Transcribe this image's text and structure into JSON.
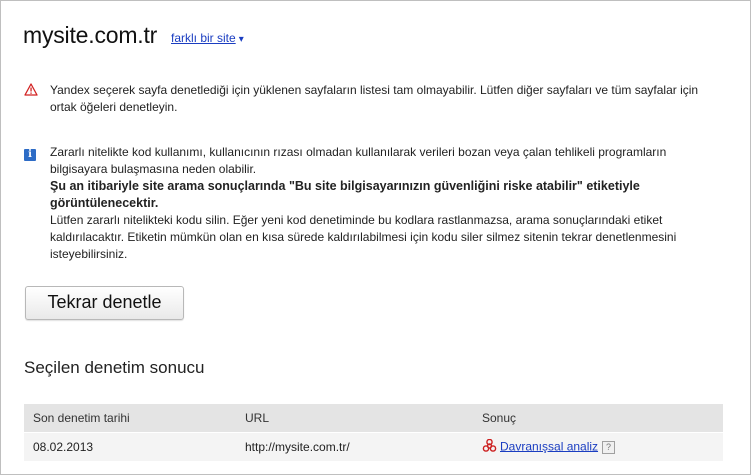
{
  "header": {
    "site_name": "mysite.com.tr",
    "switch_site_label": "farklı bir site",
    "switch_site_arrow": "▾"
  },
  "warning": {
    "icon": "warning-triangle-icon",
    "text": "Yandex seçerek sayfa denetlediği için yüklenen sayfaların listesi tam olmayabilir. Lütfen diğer sayfaları ve tüm sayfalar için ortak öğeleri denetleyin."
  },
  "info": {
    "icon": "info-icon",
    "icon_glyph": "i",
    "line1": "Zararlı nitelikte kod kullanımı, kullanıcının rızası olmadan kullanılarak verileri bozan veya çalan tehlikeli programların bilgisayara bulaşmasına neden olabilir.",
    "bold": "Şu an itibariyle site arama sonuçlarında \"Bu site bilgisayarınızın güvenliğini riske atabilir\" etiketiyle görüntülenecektir.",
    "line2": "Lütfen zararlı nitelikteki kodu silin. Eğer yeni kod denetiminde bu kodlara rastlanmazsa, arama sonuçlarındaki etiket kaldırılacaktır. Etiketin mümkün olan en kısa sürede kaldırılabilmesi için kodu siler silmez sitenin tekrar denetlenmesini isteyebilirsiniz."
  },
  "actions": {
    "recheck_label": "Tekrar denetle"
  },
  "results": {
    "title": "Seçilen denetim sonucu",
    "columns": [
      "Son denetim tarihi",
      "URL",
      "Sonuç"
    ],
    "rows": [
      {
        "date": "08.02.2013",
        "url": "http://mysite.com.tr/",
        "result": "Davranışsal analiz",
        "result_icon": "biohazard-icon",
        "help": "?"
      }
    ]
  },
  "colors": {
    "link": "#1a3dc1",
    "warning": "#d22222",
    "info": "#2d6cc6",
    "hazard": "#cc1f1f"
  }
}
